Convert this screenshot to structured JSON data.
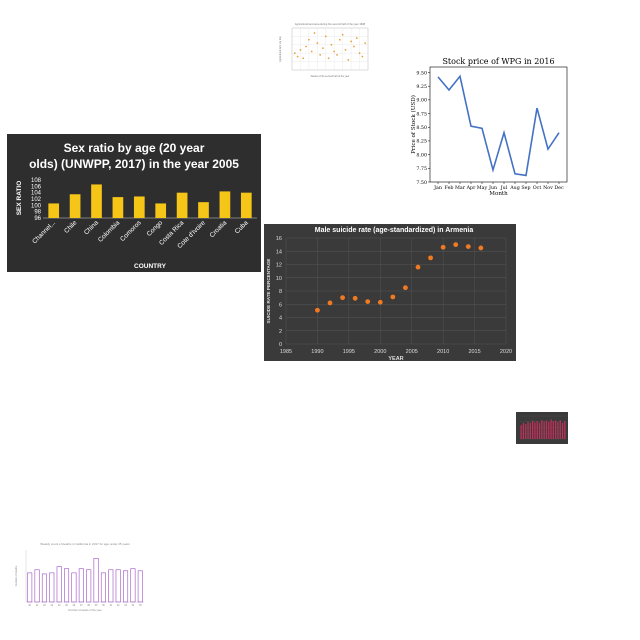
{
  "chart_data": [
    {
      "id": "scatter-small",
      "type": "scatter",
      "title": "Agricultural land area during the second half of the year 1998",
      "xlabel": "Weeks of the second half of the year",
      "ylabel": "Agricultural land (sq km)",
      "x": [
        1,
        2,
        3,
        4,
        5,
        6,
        7,
        8,
        9,
        10,
        11,
        12,
        13,
        14,
        15,
        16,
        17,
        18,
        19,
        20,
        21,
        22,
        23,
        24,
        25,
        26
      ],
      "values": [
        900,
        880,
        920,
        870,
        940,
        980,
        910,
        1020,
        960,
        890,
        930,
        1000,
        870,
        950,
        910,
        890,
        980,
        1010,
        920,
        860,
        970,
        940,
        990,
        900,
        880,
        960
      ],
      "xlim": [
        0,
        27
      ],
      "ylim": [
        800,
        1050
      ],
      "color": "#e6a13a",
      "grid": true
    },
    {
      "id": "stock",
      "type": "line",
      "title": "Stock price of WPG in 2016",
      "xlabel": "Month",
      "ylabel": "Price of Stock (USD)",
      "categories": [
        "Jan",
        "Feb",
        "Mar",
        "Apr",
        "May",
        "Jun",
        "Jul",
        "Aug",
        "Sep",
        "Oct",
        "Nov",
        "Dec"
      ],
      "values": [
        9.42,
        9.18,
        9.43,
        8.52,
        8.48,
        7.72,
        8.4,
        7.65,
        7.62,
        8.85,
        8.1,
        8.4
      ],
      "yticks": [
        "7.50",
        "7.75",
        "8.00",
        "8.25",
        "8.50",
        "8.75",
        "9.00",
        "9.25",
        "9.50"
      ],
      "ylim": [
        7.5,
        9.6
      ],
      "color": "#4472c4",
      "grid": false
    },
    {
      "id": "sexratio",
      "type": "bar",
      "title": "Sex ratio by age (20 year olds) (UNWPP, 2017) in the year 2005",
      "xlabel": "COUNTRY",
      "ylabel": "SEX RATIO",
      "categories": [
        "Channel...",
        "Chile",
        "China",
        "Colombia",
        "Comoros",
        "Congo",
        "Costa Rica",
        "Cote d'Ivoire",
        "Croatia",
        "Cuba"
      ],
      "values": [
        100.6,
        103.5,
        106.6,
        102.6,
        102.8,
        100.6,
        104.0,
        101.0,
        104.4,
        104.0
      ],
      "yticks": [
        "96",
        "98",
        "100",
        "102",
        "104",
        "106",
        "108"
      ],
      "ylim": [
        96,
        108
      ],
      "color": "#f5c518",
      "grid": false
    },
    {
      "id": "suicide",
      "type": "scatter",
      "title": "Male suicide rate (age-standardized) in Armenia",
      "xlabel": "YEAR",
      "ylabel": "SUICIDE RATE PERCENTAGE",
      "x": [
        1990,
        1992,
        1994,
        1996,
        1998,
        2000,
        2002,
        2004,
        2006,
        2008,
        2010,
        2012,
        2014,
        2016
      ],
      "values": [
        5.1,
        6.2,
        7.0,
        6.9,
        6.4,
        6.3,
        7.1,
        8.5,
        11.6,
        13.0,
        14.6,
        15.0,
        14.7,
        14.5
      ],
      "xticks": [
        "1985",
        "1990",
        "1995",
        "2000",
        "2005",
        "2010",
        "2015",
        "2020"
      ],
      "yticks": [
        "0",
        "2",
        "4",
        "6",
        "8",
        "10",
        "12",
        "14",
        "16"
      ],
      "xlim": [
        1985,
        2020
      ],
      "ylim": [
        0,
        16
      ],
      "color": "#f07a22",
      "grid": true
    },
    {
      "id": "tiny",
      "type": "bar",
      "values": [
        0.6,
        0.7,
        0.65,
        0.75,
        0.7,
        0.8,
        0.72,
        0.78,
        0.7,
        0.82,
        0.76,
        0.8,
        0.74,
        0.85,
        0.78,
        0.8,
        0.75,
        0.82,
        0.7,
        0.78
      ],
      "ylim": [
        0,
        1
      ],
      "color": "#c0305a",
      "grid": true
    },
    {
      "id": "weekly",
      "type": "bar",
      "title": "Weekly count of deaths in California in 2017 for age under 25 years",
      "xlabel": "Number of weeks of the year",
      "ylabel": "Number of deaths",
      "categories": [
        "20",
        "21",
        "22",
        "23",
        "24",
        "25",
        "26",
        "27",
        "28",
        "29",
        "30",
        "31",
        "32",
        "33",
        "34",
        "35"
      ],
      "values": [
        140,
        155,
        135,
        140,
        170,
        160,
        140,
        160,
        155,
        210,
        140,
        155,
        155,
        150,
        160,
        150
      ],
      "ylim": [
        0,
        250
      ],
      "color": "#9c4fc4",
      "grid": false
    }
  ]
}
